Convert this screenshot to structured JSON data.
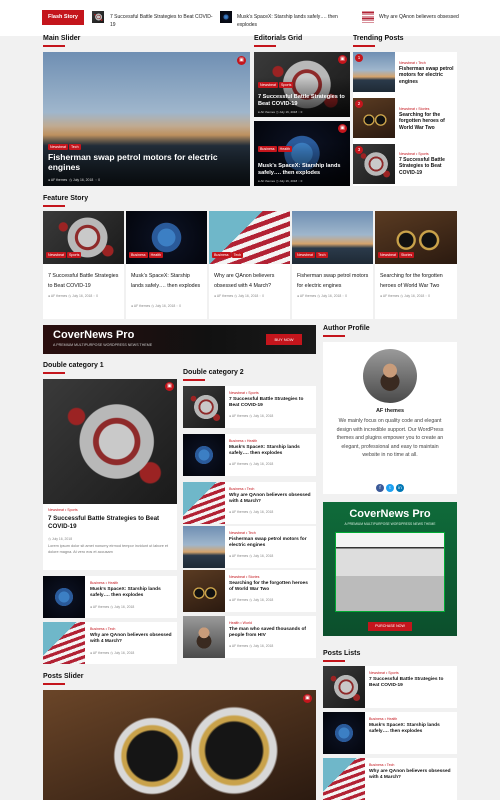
{
  "ticker": {
    "label": "Flash Story",
    "items": [
      "7 Successful Battle Strategies to Beat COVID-19",
      "Musk’s SpaceX: Starship lands safely…. then explodes",
      "Why are QAnon believers obsessed"
    ]
  },
  "sections": {
    "main_slider": "Main Slider",
    "editorials": "Editorials Grid",
    "trending": "Trending Posts",
    "feature": "Feature Story",
    "double1": "Double category 1",
    "double2": "Double category 2",
    "author": "Author Profile",
    "posts_slider": "Posts Slider",
    "posts_lists": "Posts Lists"
  },
  "main_slider": {
    "cats": [
      "Newsbeat",
      "Tech"
    ],
    "title": "Fisherman swap petrol motors for electric engines",
    "author": "AF themes",
    "date": "July 16, 2018",
    "comments": "0"
  },
  "editorials": [
    {
      "cats": [
        "Newsbeat",
        "Sports"
      ],
      "title": "7 Successful Battle Strategies to Beat COVID-19",
      "author": "AF themes",
      "date": "July 16, 2018",
      "comments": "0"
    },
    {
      "cats": [
        "Business",
        "Health"
      ],
      "title": "Musk’s SpaceX: Starship lands safely…. then explodes",
      "author": "AF themes",
      "date": "July 16, 2018",
      "comments": "0"
    }
  ],
  "trending": [
    {
      "num": "1",
      "cats": [
        "Newsbeat",
        "Tech"
      ],
      "title": "Fisherman swap petrol motors for electric engines"
    },
    {
      "num": "2",
      "cats": [
        "Newsbeat",
        "Stories"
      ],
      "title": "Searching for the forgotten heroes of World War Two"
    },
    {
      "num": "3",
      "cats": [
        "Newsbeat",
        "Sports"
      ],
      "title": "7 Successful Battle Strategies to Beat COVID-19"
    }
  ],
  "feature": [
    {
      "cats": [
        "Newsbeat",
        "Sports"
      ],
      "title": "7 Successful Battle Strategies to Beat COVID-19",
      "author": "AF themes",
      "date": "July 16, 2018",
      "comments": "0"
    },
    {
      "cats": [
        "Business",
        "Health"
      ],
      "title": "Musk’s SpaceX: Starship lands safely…. then explodes",
      "author": "AF themes",
      "date": "July 16, 2018",
      "comments": "0"
    },
    {
      "cats": [
        "Business",
        "Tech"
      ],
      "title": "Why are QAnon believers obsessed with 4 March?",
      "author": "AF themes",
      "date": "July 16, 2018",
      "comments": "0"
    },
    {
      "cats": [
        "Newsbeat",
        "Tech"
      ],
      "title": "Fisherman swap petrol motors for electric engines",
      "author": "AF themes",
      "date": "July 16, 2018",
      "comments": "0"
    },
    {
      "cats": [
        "Newsbeat",
        "Stories"
      ],
      "title": "Searching for the forgotten heroes of World War Two",
      "author": "AF themes",
      "date": "July 16, 2018",
      "comments": "0"
    }
  ],
  "ad_banner": {
    "title": "CoverNews Pro",
    "subtitle": "A PREMIUM MULTIPURPOSE WORDPRESS NEWS THEME",
    "button": "BUY NOW"
  },
  "double1": {
    "main": {
      "cats": [
        "Newsbeat",
        "Sports"
      ],
      "title": "7 Successful Battle Strategies to Beat COVID-19",
      "date": "July 16, 2018",
      "excerpt": "Lorem ipsum dolor sit amet nonumy eirmod tempor invidunt ut labore et dolore magna. At vero eos et accusam"
    },
    "list": [
      {
        "cats": [
          "Business",
          "Health"
        ],
        "title": "Musk’s SpaceX: Starship lands safely…. then explodes",
        "author": "AF themes",
        "date": "July 16, 2018"
      },
      {
        "cats": [
          "Business",
          "Tech"
        ],
        "title": "Why are QAnon believers obsessed with 4 March?",
        "author": "AF themes",
        "date": "July 16, 2018"
      }
    ]
  },
  "double2": [
    {
      "cats": [
        "Newsbeat",
        "Sports"
      ],
      "title": "7 Successful Battle Strategies to Beat COVID-19",
      "author": "AF themes",
      "date": "July 16, 2018"
    },
    {
      "cats": [
        "Business",
        "Health"
      ],
      "title": "Musk’s SpaceX: Starship lands safely…. then explodes",
      "author": "AF themes",
      "date": "July 16, 2018"
    },
    {
      "cats": [
        "Business",
        "Tech"
      ],
      "title": "Why are QAnon believers obsessed with 4 March?",
      "author": "AF themes",
      "date": "July 16, 2018"
    },
    {
      "cats": [
        "Newsbeat",
        "Tech"
      ],
      "title": "Fisherman swap petrol motors for electric engines",
      "author": "AF themes",
      "date": "July 16, 2018"
    },
    {
      "cats": [
        "Newsbeat",
        "Stories"
      ],
      "title": "Searching for the forgotten heroes of World War Two",
      "author": "AF themes",
      "date": "July 16, 2018"
    },
    {
      "cats": [
        "Health",
        "World"
      ],
      "title": "The man who saved thousands of people from HIV",
      "author": "AF themes",
      "date": "July 16, 2018"
    }
  ],
  "author": {
    "name": "AF themes",
    "bio": "We mainly focus on quality code and elegant design with incredible support. Our WordPress themes and plugins empower you to create an elegant, professional and easy to maintain website in no time at all."
  },
  "ad_side": {
    "title": "CoverNews Pro",
    "subtitle": "A PREMIUM MULTIPURPOSE WORDPRESS NEWS THEME",
    "button": "PURCHASE NOW"
  },
  "posts_lists": [
    {
      "cats": [
        "Newsbeat",
        "Sports"
      ],
      "title": "7 Successful Battle Strategies to Beat COVID-19"
    },
    {
      "cats": [
        "Business",
        "Health"
      ],
      "title": "Musk’s SpaceX: Starship lands safely…. then explodes"
    },
    {
      "cats": [
        "Business",
        "Tech"
      ],
      "title": "Why are QAnon believers obsessed with 4 March?"
    }
  ],
  "colors": {
    "accent": "#c4151c",
    "background": "#f1f1f1"
  }
}
